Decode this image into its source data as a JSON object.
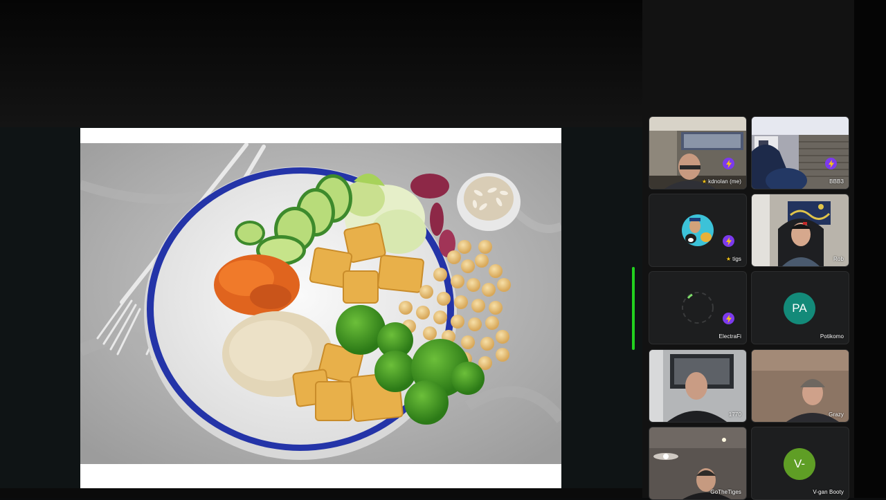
{
  "presentation": {
    "slide_image": "vegan buddha bowl photo",
    "active_speaker_color": "#22d11f"
  },
  "participants": [
    {
      "name": "kdnolan (me)",
      "starred": true,
      "effect_icon": "lightning-bolt-icon",
      "video": true
    },
    {
      "name": "BBB3",
      "starred": false,
      "effect_icon": "lightning-bolt-icon",
      "video": true
    },
    {
      "name": "tigs",
      "starred": true,
      "effect_icon": "lightning-bolt-icon",
      "video": false,
      "avatar": "profile-picture"
    },
    {
      "name": "Rob",
      "starred": false,
      "video": true
    },
    {
      "name": "ElectraFi",
      "starred": false,
      "effect_icon": "lightning-bolt-icon",
      "video": false,
      "avatar": "loading-spinner"
    },
    {
      "name": "Potikomo",
      "starred": false,
      "video": false,
      "initials": "PA",
      "avatar_color": "#138a79"
    },
    {
      "name": "1770",
      "starred": false,
      "video": true
    },
    {
      "name": "Grazy",
      "starred": false,
      "video": true
    },
    {
      "name": "GoTheTiges",
      "starred": false,
      "video": true
    },
    {
      "name": "V-gan Booty",
      "starred": false,
      "video": false,
      "initials": "V-",
      "avatar_color": "#5f9e25"
    }
  ],
  "colors": {
    "bolt_badge": "#7c3aed",
    "star": "#f5c518"
  }
}
